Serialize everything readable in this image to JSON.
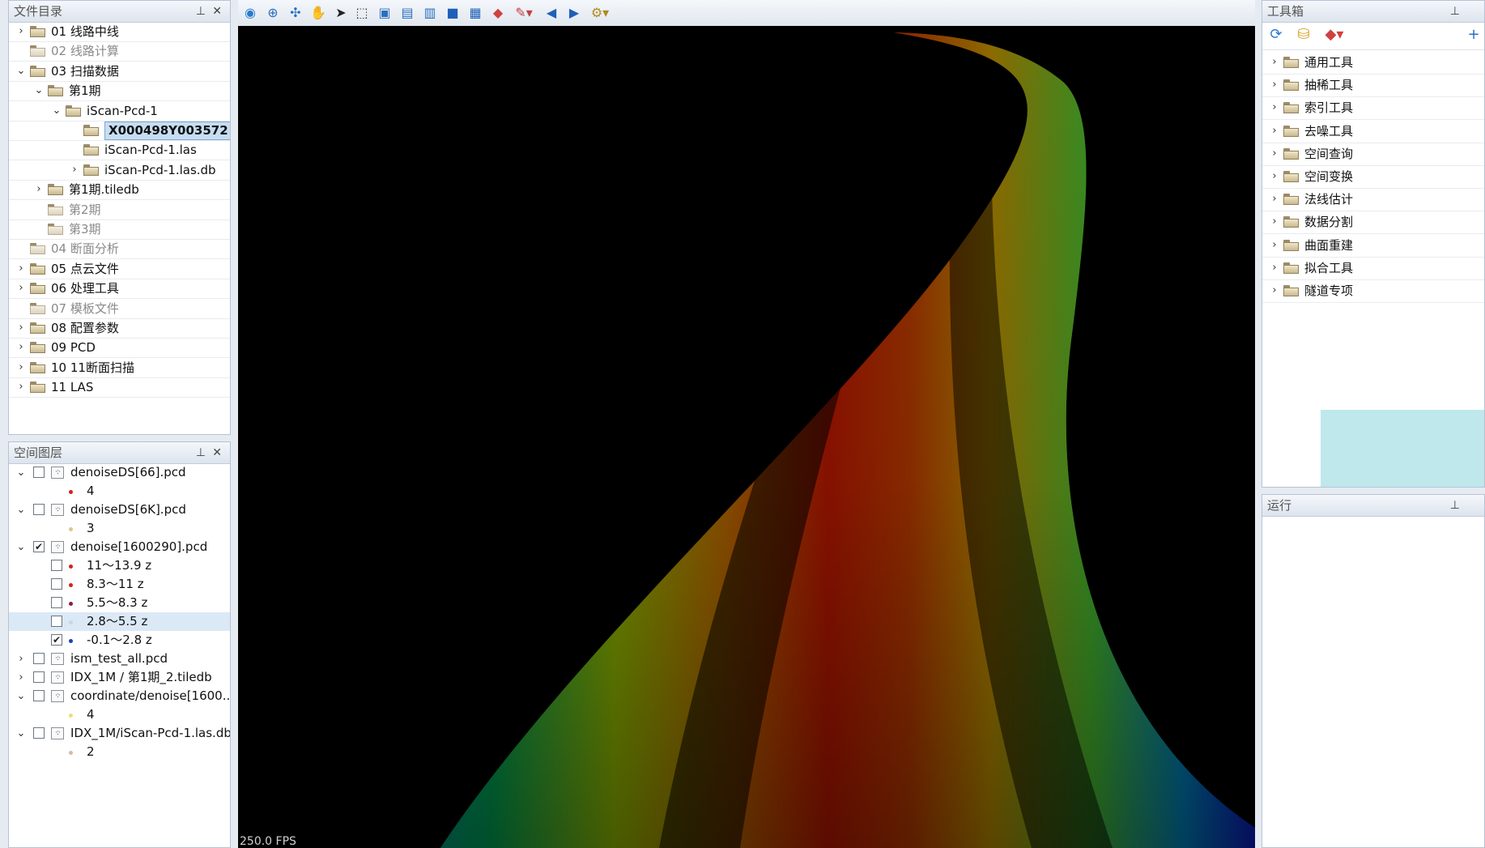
{
  "file_panel": {
    "title": "文件目录",
    "items": [
      {
        "label": "01 线路中线",
        "dim": false,
        "chev": "›"
      },
      {
        "label": "02 线路计算",
        "dim": true,
        "chev": ""
      },
      {
        "label": "03 扫描数据",
        "dim": false,
        "chev": "⌄"
      },
      {
        "label": "第1期",
        "dim": false,
        "chev": "⌄"
      },
      {
        "label": "iScan-Pcd-1",
        "dim": false,
        "chev": "⌄"
      },
      {
        "label": "X000498Y003572",
        "dim": false,
        "chev": "",
        "selected": true
      },
      {
        "label": "iScan-Pcd-1.las",
        "dim": false,
        "chev": ""
      },
      {
        "label": "iScan-Pcd-1.las.db",
        "dim": false,
        "chev": "›"
      },
      {
        "label": "第1期.tiledb",
        "dim": false,
        "chev": "›"
      },
      {
        "label": "第2期",
        "dim": true,
        "chev": ""
      },
      {
        "label": "第3期",
        "dim": true,
        "chev": ""
      },
      {
        "label": "04 断面分析",
        "dim": true,
        "chev": ""
      },
      {
        "label": "05 点云文件",
        "dim": false,
        "chev": "›"
      },
      {
        "label": "06 处理工具",
        "dim": false,
        "chev": "›"
      },
      {
        "label": "07 模板文件",
        "dim": true,
        "chev": ""
      },
      {
        "label": "08 配置参数",
        "dim": false,
        "chev": "›"
      },
      {
        "label": "09 PCD",
        "dim": false,
        "chev": "›"
      },
      {
        "label": "10 11断面扫描",
        "dim": false,
        "chev": "›"
      },
      {
        "label": "11 LAS",
        "dim": false,
        "chev": "›"
      }
    ]
  },
  "layer_panel": {
    "title": "空间图层",
    "items": [
      {
        "label": "denoiseDS[66].pcd",
        "checked": false,
        "chev": "⌄"
      },
      {
        "label": "4",
        "color": "#d42020"
      },
      {
        "label": "denoiseDS[6K].pcd",
        "checked": false,
        "chev": "⌄"
      },
      {
        "label": "3",
        "color": "#d8c98a"
      },
      {
        "label": "denoise[1600290].pcd",
        "checked": true,
        "chev": "⌄"
      },
      {
        "label": "11～13.9 z",
        "checked": false,
        "color": "#d42020"
      },
      {
        "label": "8.3～11 z",
        "checked": false,
        "color": "#d42020"
      },
      {
        "label": "5.5～8.3 z",
        "checked": false,
        "color": "#8a1f3a"
      },
      {
        "label": "2.8～5.5 z",
        "checked": false,
        "color": "#c9d5e6",
        "hl": true
      },
      {
        "label": "-0.1～2.8 z",
        "checked": true,
        "color": "#1a3fc0"
      },
      {
        "label": "ism_test_all.pcd",
        "checked": false,
        "chev": "›"
      },
      {
        "label": "IDX_1M / 第1期_2.tiledb",
        "checked": false,
        "chev": "›"
      },
      {
        "label": "coordinate/denoise[1600...",
        "checked": false,
        "chev": "⌄"
      },
      {
        "label": "4",
        "color": "#e9e07a"
      },
      {
        "label": "IDX_1M/iScan-Pcd-1.las.db",
        "checked": false,
        "chev": "⌄"
      },
      {
        "label": "2",
        "color": "#d9b8a8"
      }
    ]
  },
  "toolbox_panel": {
    "title": "工具箱",
    "items": [
      "通用工具",
      "抽稀工具",
      "索引工具",
      "去噪工具",
      "空间查询",
      "空间变换",
      "法线估计",
      "数据分割",
      "曲面重建",
      "拟合工具",
      "隧道专项"
    ]
  },
  "run_panel": {
    "title": "运行"
  },
  "viewport": {
    "fps": "250.0 FPS"
  },
  "icons": {
    "toolbar": [
      "globe-icon",
      "zoom-in-icon",
      "pan-target-icon",
      "hand-icon",
      "pointer-icon",
      "select-rect-icon",
      "select-layer-icon",
      "select-box-icon",
      "frame-icon",
      "fill-icon",
      "screen-icon",
      "eraser-icon",
      "edit-dropdown-icon",
      "arrow-left-icon",
      "arrow-right-icon",
      "settings-dropdown-icon"
    ],
    "pin": "pin-icon",
    "close": "close-icon",
    "toolbox_top": [
      "refresh-icon",
      "database-icon",
      "eraser-dropdown-icon",
      "add-icon"
    ]
  }
}
